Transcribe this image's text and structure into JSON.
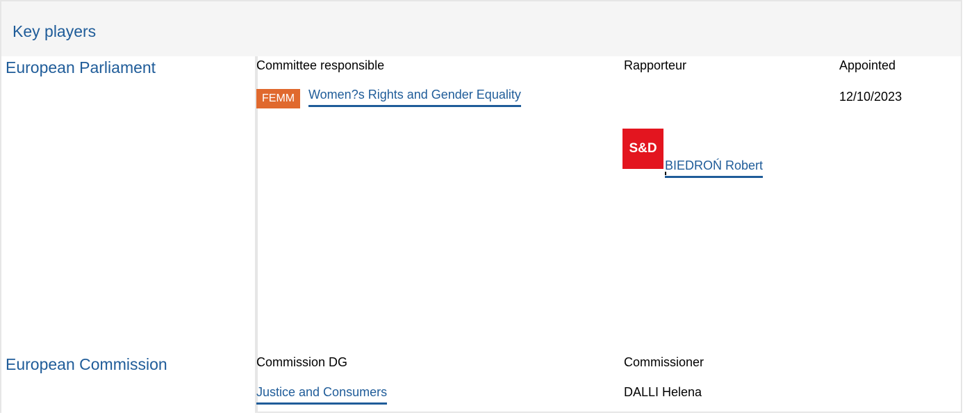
{
  "title": "Key players",
  "parliament": {
    "label": "European Parliament",
    "headers": {
      "committee": "Committee responsible",
      "rapporteur": "Rapporteur",
      "appointed": "Appointed"
    },
    "committee": {
      "badge": "FEMM",
      "name": "Women?s Rights and Gender Equality",
      "badge_color": "#e0692e"
    },
    "appointed_date": "12/10/2023",
    "rapporteur": {
      "group_logo": "S&D",
      "group_color": "#e3151f",
      "name": "BIEDROŃ Robert"
    }
  },
  "commission": {
    "label": "European Commission",
    "headers": {
      "dg": "Commission DG",
      "commissioner": "Commissioner"
    },
    "dg": "Justice and Consumers",
    "commissioner": "DALLI Helena"
  },
  "colors": {
    "link": "#1f5c99",
    "header_bg": "#f5f5f5",
    "divider": "#e6e6e6"
  }
}
